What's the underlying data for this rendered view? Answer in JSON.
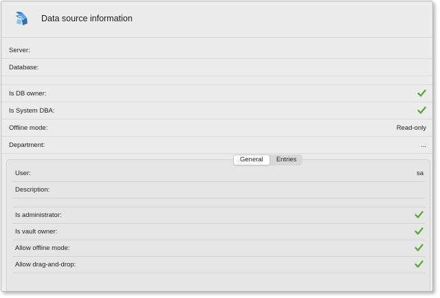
{
  "window": {
    "title": "Data source information"
  },
  "colors": {
    "check": "#5aa93a",
    "background": "#ececec"
  },
  "icons": {
    "logo": "vault-logo-icon",
    "check": "check-icon"
  },
  "datasource": {
    "server_label": "Server:",
    "database_label": "Database:",
    "db_owner_label": "Is DB owner:",
    "db_owner": true,
    "system_dba_label": "Is System DBA:",
    "system_dba": true,
    "offline_mode_label": "Offline mode:",
    "offline_mode_value": "Read-only",
    "department_label": "Department:",
    "department_value": "..."
  },
  "tabs": [
    {
      "label": "General",
      "active": true
    },
    {
      "label": "Entries",
      "active": false
    }
  ],
  "general": {
    "user_label": "User:",
    "user_value": "sa",
    "description_label": "Description:",
    "is_admin_label": "Is administrator:",
    "is_admin": true,
    "vault_owner_label": "Is vault owner:",
    "vault_owner": true,
    "allow_offline_label": "Allow offline mode:",
    "allow_offline": true,
    "allow_dnd_label": "Allow drag-and-drop:",
    "allow_dnd": true
  }
}
